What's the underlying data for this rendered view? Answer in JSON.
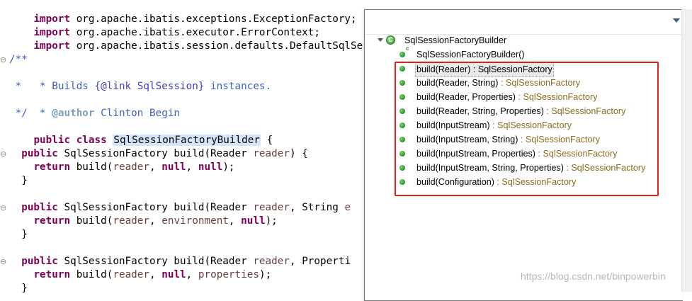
{
  "editor": {
    "import1": "import org.apache.ibatis.exceptions.ExceptionFactory;",
    "import2": "import org.apache.ibatis.executor.ErrorContext;",
    "import3": "import org.apache.ibatis.session.defaults.DefaultSqlSess",
    "doc_open": "/**",
    "doc_line1_prefix": " * Builds ",
    "doc_line1_ref": "{@link SqlSession}",
    "doc_line1_suffix": " instances.",
    "doc_blank": " *",
    "doc_author_prefix": " * ",
    "doc_author_tag": "@author",
    "doc_author_name": " Clinton Begin",
    "doc_close": " */",
    "class_kw": "public class ",
    "class_name": "SqlSessionFactoryBuilder",
    "class_brace": " {",
    "m1_sig": "  public SqlSessionFactory build(Reader reader) {",
    "m1_body": "    return build(reader, null, null);",
    "m2_sig": "  public SqlSessionFactory build(Reader reader, String e",
    "m2_body": "    return build(reader, environment, null);",
    "m3_sig": "  public SqlSessionFactory build(Reader reader, Properti",
    "m3_body": "    return build(reader, null, properties);",
    "close_brace": "  }",
    "fold_marker": "⊖"
  },
  "outline": {
    "class_name": "SqlSessionFactoryBuilder",
    "constructor": "SqlSessionFactoryBuilder()",
    "constructor_badge": "c",
    "methods": [
      {
        "sig": "build(Reader)",
        "ret": "SqlSessionFactory"
      },
      {
        "sig": "build(Reader, String)",
        "ret": "SqlSessionFactory"
      },
      {
        "sig": "build(Reader, Properties)",
        "ret": "SqlSessionFactory"
      },
      {
        "sig": "build(Reader, String, Properties)",
        "ret": "SqlSessionFactory"
      },
      {
        "sig": "build(InputStream)",
        "ret": "SqlSessionFactory"
      },
      {
        "sig": "build(InputStream, String)",
        "ret": "SqlSessionFactory"
      },
      {
        "sig": "build(InputStream, Properties)",
        "ret": "SqlSessionFactory"
      },
      {
        "sig": "build(InputStream, String, Properties)",
        "ret": "SqlSessionFactory"
      },
      {
        "sig": "build(Configuration)",
        "ret": "SqlSessionFactory"
      }
    ],
    "separator": " : "
  },
  "watermark": "https://blog.csdn.net/binpowerbin",
  "colors": {
    "keyword": "#7f0055",
    "javadoc": "#3f5fbf",
    "return_type": "#8a6b1e",
    "annotation_box": "#e02020",
    "method_icon": "#2e9a2e"
  }
}
